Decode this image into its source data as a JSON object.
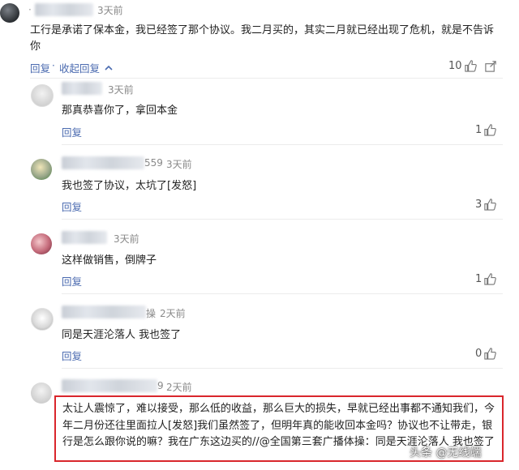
{
  "top_comment": {
    "time": "3天前",
    "content_line1": "工行是承诺了保本金，我已经签了那个协议。我二月买的，其实二月就已经出现了危机，就是不告诉",
    "content_line2": "你",
    "reply_label": "回复",
    "collapse_label": "收起回复",
    "collapse_arrow": "chevron-up-icon",
    "likes": "10"
  },
  "replies": [
    {
      "name_tail": "",
      "time": "3天前",
      "content": "那真恭喜你了，拿回本金",
      "reply_label": "回复",
      "likes": "1"
    },
    {
      "name_tail": "559",
      "time": "3天前",
      "content": "我也签了协议，太坑了[发怒]",
      "reply_label": "回复",
      "likes": "3"
    },
    {
      "name_tail": "",
      "time": "3天前",
      "content": "这样做销售，倒牌子",
      "reply_label": "回复",
      "likes": "1"
    },
    {
      "name_tail": "操",
      "time": "2天前",
      "content": "同是天涯沦落人 我也签了",
      "reply_label": "回复",
      "likes": "0"
    },
    {
      "name_tail": "9",
      "time": "2天前",
      "content": "太让人震惊了，难以接受，那么低的收益，那么巨大的损失，早就已经出事都不通知我们，今年二月份还往里面拉人[发怒]我们虽然签了，但明年真的能收回本金吗？协议也不让带走，银行是怎么跟你说的嘛？我在广东这边买的//@全国第三套广播体操：同是天涯沦落人 我也签了"
    }
  ],
  "separator": "·",
  "watermark": "头条 @无线端",
  "colors": {
    "link": "#4b6bb0",
    "highlight_border": "#d9262c"
  }
}
